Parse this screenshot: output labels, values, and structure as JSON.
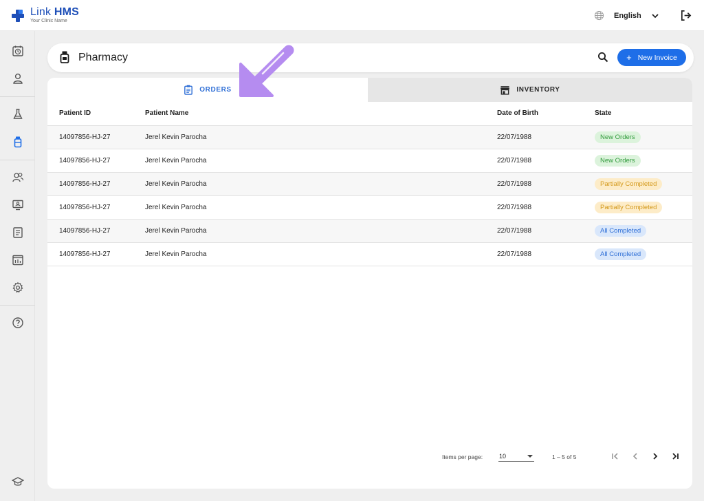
{
  "app": {
    "brand_light": "Link",
    "brand_bold": "HMS",
    "subtitle": "Your Clinic Name",
    "language": "English"
  },
  "header": {
    "title": "Pharmacy",
    "new_invoice_label": "New Invoice",
    "new_invoice_icon": "plus"
  },
  "tabs": [
    {
      "label": "ORDERS",
      "icon": "clipboard-icon",
      "active": true
    },
    {
      "label": "INVENTORY",
      "icon": "store-icon",
      "active": false
    }
  ],
  "table": {
    "columns": [
      "Patient ID",
      "Patient Name",
      "Date of Birth",
      "State"
    ],
    "rows": [
      {
        "patient_id": "14097856-HJ-27",
        "patient_name": "Jerel Kevin Parocha",
        "dob": "22/07/1988",
        "state": "New Orders",
        "state_kind": "new"
      },
      {
        "patient_id": "14097856-HJ-27",
        "patient_name": "Jerel Kevin Parocha",
        "dob": "22/07/1988",
        "state": "New Orders",
        "state_kind": "new"
      },
      {
        "patient_id": "14097856-HJ-27",
        "patient_name": "Jerel Kevin Parocha",
        "dob": "22/07/1988",
        "state": "Partially Completed",
        "state_kind": "partial"
      },
      {
        "patient_id": "14097856-HJ-27",
        "patient_name": "Jerel Kevin Parocha",
        "dob": "22/07/1988",
        "state": "Partially Completed",
        "state_kind": "partial"
      },
      {
        "patient_id": "14097856-HJ-27",
        "patient_name": "Jerel Kevin Parocha",
        "dob": "22/07/1988",
        "state": "All Completed",
        "state_kind": "all"
      },
      {
        "patient_id": "14097856-HJ-27",
        "patient_name": "Jerel Kevin Parocha",
        "dob": "22/07/1988",
        "state": "All Completed",
        "state_kind": "all"
      }
    ]
  },
  "pagination": {
    "items_per_page_label": "Items per page:",
    "items_per_page": "10",
    "range": "1 – 5 of 5"
  },
  "colors": {
    "accent": "#1e6ee8",
    "brand": "#1e4fb8",
    "annotation_arrow": "#b58cf0"
  }
}
